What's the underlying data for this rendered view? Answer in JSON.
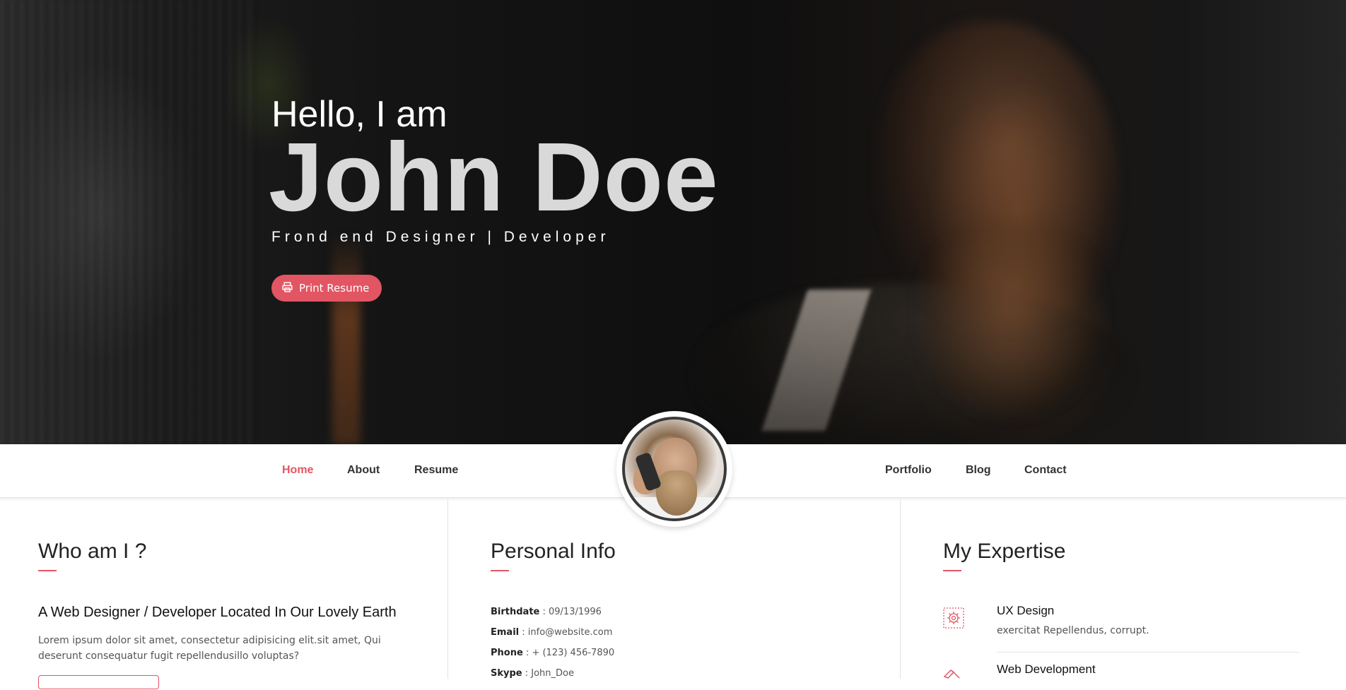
{
  "hero": {
    "greeting": "Hello, I am",
    "name": "John Doe",
    "tagline": "Frond end Designer | Developer",
    "print_button": "Print Resume",
    "print_icon": "printer-icon"
  },
  "nav": {
    "left": [
      "Home",
      "About",
      "Resume"
    ],
    "right": [
      "Portfolio",
      "Blog",
      "Contact"
    ],
    "active": "Home"
  },
  "who": {
    "title": "Who am I ?",
    "subtitle": "A Web Designer / Developer Located In Our Lovely Earth",
    "text": "Lorem ipsum dolor sit amet, consectetur adipisicing elit.sit amet, Qui deserunt consequatur fugit repellendusillo voluptas?"
  },
  "personal": {
    "title": "Personal Info",
    "rows": [
      {
        "label": "Birthdate",
        "value": " : 09/13/1996"
      },
      {
        "label": "Email",
        "value": " : info@website.com"
      },
      {
        "label": "Phone",
        "value": " : + (123) 456-7890"
      },
      {
        "label": "Skype",
        "value": " : John_Doe"
      }
    ]
  },
  "expertise": {
    "title": "My Expertise",
    "items": [
      {
        "title": "UX Design",
        "desc": "exercitat Repellendus, corrupt.",
        "icon": "gear-icon"
      },
      {
        "title": "Web Development",
        "desc": "",
        "icon": "code-icon"
      }
    ]
  },
  "colors": {
    "accent": "#e25563",
    "text": "#333333"
  }
}
